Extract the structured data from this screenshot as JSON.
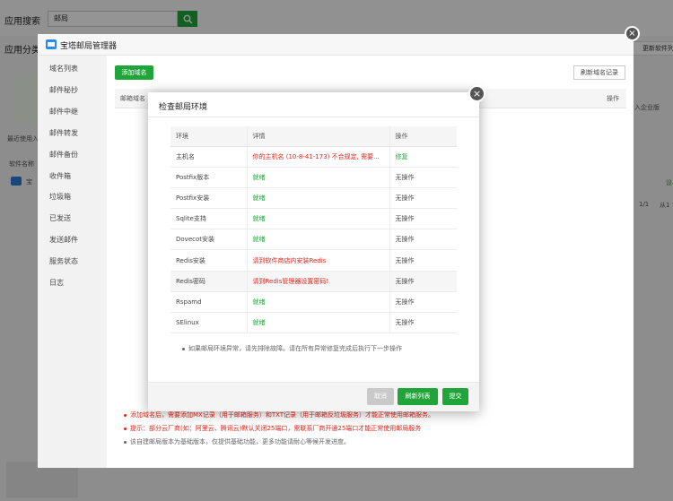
{
  "background": {
    "search_label": "应用搜索",
    "search_value": "邮局",
    "category_label": "应用分类",
    "update_button": "更新软件列",
    "recent_label": "最近使用入",
    "software_label": "软件名称",
    "software_item": "宝",
    "side_text_1": "入企业版",
    "side_text_2": "设",
    "pager_text": "1/1",
    "pager_from": "从1"
  },
  "manager": {
    "title": "宝塔邮局管理器",
    "sidebar": [
      "域名列表",
      "邮件秘抄",
      "邮件中继",
      "邮件转发",
      "邮件备份",
      "收件箱",
      "垃圾箱",
      "已发送",
      "发送邮件",
      "服务状态",
      "日志"
    ],
    "add_domain": "添加域名",
    "refresh_records": "刷新域名记录",
    "table_header": {
      "domain": "邮箱域名",
      "action": "操作"
    },
    "tips": [
      "添加域名后，需要添加MX记录（用于邮箱服务）和TXT记录（用于邮箱反垃圾服务）才能正常使用邮箱服务。",
      "提示：部分云厂商(如：阿里云、腾讯云)默认关闭25端口，需联系厂商开通25端口才能正常使用邮局服务",
      "该自建邮局版本为基础版本，仅提供基础功能，更多功能请耐心等候开发进度。"
    ]
  },
  "dialog": {
    "title": "检查邮局环境",
    "columns": {
      "env": "环境",
      "detail": "详情",
      "action": "操作"
    },
    "rows": [
      {
        "env": "主机名",
        "detail": "你的主机名 (10-8-41-173) 不合规定, 需要...",
        "action": "修复",
        "detail_status": "error",
        "action_status": "ok"
      },
      {
        "env": "Postfix版本",
        "detail": "就绪",
        "action": "无操作",
        "detail_status": "ok"
      },
      {
        "env": "Postfix安装",
        "detail": "就绪",
        "action": "无操作",
        "detail_status": "ok"
      },
      {
        "env": "Sqlite支持",
        "detail": "就绪",
        "action": "无操作",
        "detail_status": "ok"
      },
      {
        "env": "Dovecot安装",
        "detail": "就绪",
        "action": "无操作",
        "detail_status": "ok"
      },
      {
        "env": "Redis安装",
        "detail": "请到软件商店内安装Redis",
        "action": "无操作",
        "detail_status": "error"
      },
      {
        "env": "Redis密码",
        "detail": "请到Redis管理器设置密码!",
        "action": "无操作",
        "detail_status": "error"
      },
      {
        "env": "Rspamd",
        "detail": "就绪",
        "action": "无操作",
        "detail_status": "ok"
      },
      {
        "env": "SElinux",
        "detail": "就绪",
        "action": "无操作",
        "detail_status": "ok"
      }
    ],
    "note": "如果邮局环境异常，请先排除故障。请在所有异常修复完成后执行下一步操作",
    "cancel": "取消",
    "refresh": "刷新列表",
    "submit": "提交"
  },
  "colors": {
    "green": "#20a53a",
    "red": "#e0261a"
  }
}
